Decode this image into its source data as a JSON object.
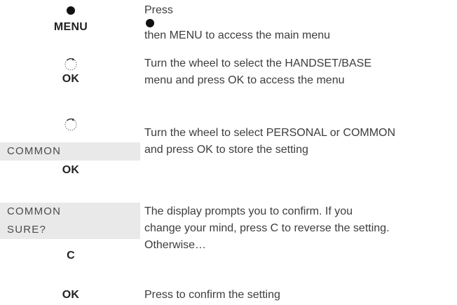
{
  "steps": [
    {
      "keys": [
        "MENU"
      ],
      "instruction_before_dot": "Press",
      "instruction_after_dot": "then MENU to access the main menu"
    },
    {
      "keys": [
        "OK"
      ],
      "instruction_lines": [
        "Turn the wheel to select the HANDSET/BASE",
        "menu and press OK to access the menu"
      ]
    },
    {
      "display": [
        "COMMON"
      ],
      "keys": [
        "OK"
      ],
      "instruction_lines": [
        "Turn the wheel to select PERSONAL or COMMON",
        "and press OK to store the setting"
      ]
    },
    {
      "display": [
        "COMMON",
        "SURE?"
      ],
      "keys": [
        "C"
      ],
      "instruction_lines": [
        "The display prompts you to confirm. If you",
        "change your mind, press C to reverse the setting.",
        "Otherwise…"
      ]
    },
    {
      "keys": [
        "OK"
      ],
      "instruction_lines": [
        "Press to confirm the setting"
      ]
    }
  ],
  "icons": {
    "dot_button": "filled-dot-icon",
    "wheel": "wheel-rotate-icon"
  },
  "colors": {
    "display_background": "#e9e9e9",
    "text": "#3d3d3d",
    "key_text": "#222222"
  }
}
